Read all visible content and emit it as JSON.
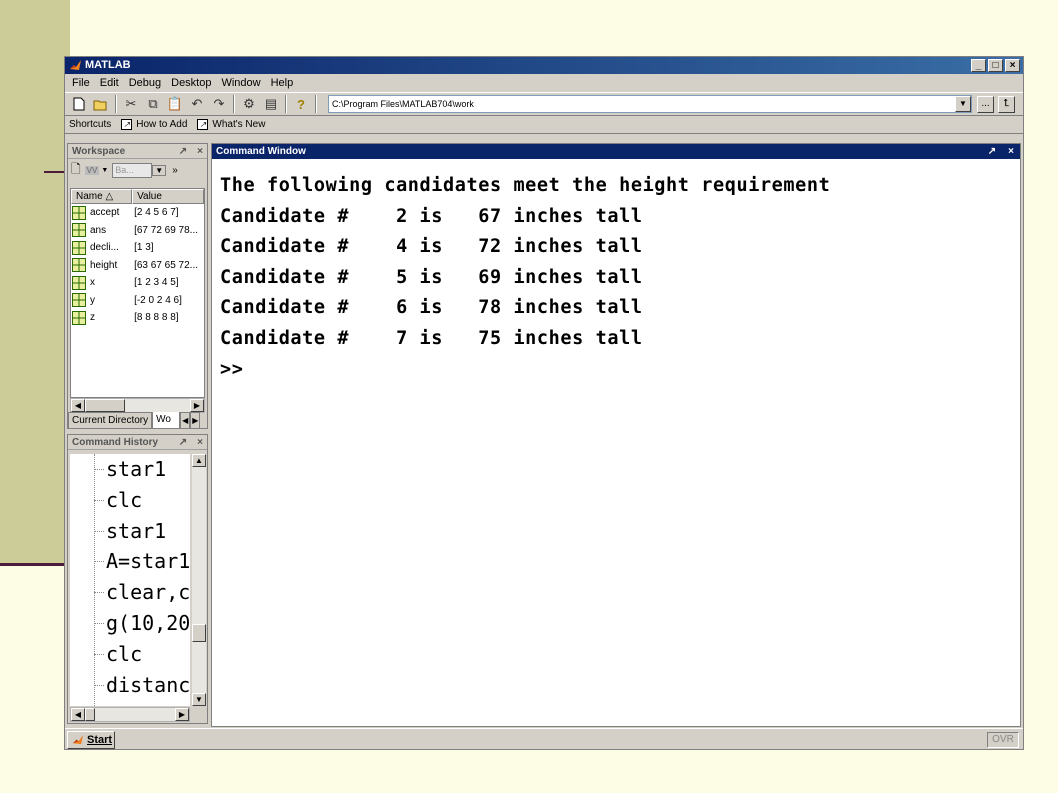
{
  "window": {
    "title": "MATLAB"
  },
  "menu": [
    "File",
    "Edit",
    "Debug",
    "Desktop",
    "Window",
    "Help"
  ],
  "toolbar": {
    "current_directory": "C:\\Program Files\\MATLAB704\\work",
    "browse_label": "..."
  },
  "shortcuts": {
    "label": "Shortcuts",
    "items": [
      "How to Add",
      "What's New"
    ]
  },
  "workspace": {
    "title": "Workspace",
    "combo_value": "Ba...",
    "columns": [
      "Name △",
      "Value"
    ],
    "rows": [
      {
        "name": "accept",
        "value": "[2 4 5 6 7]"
      },
      {
        "name": "ans",
        "value": "[67 72 69 78..."
      },
      {
        "name": "decli...",
        "value": "[1 3]"
      },
      {
        "name": "height",
        "value": "[63 67 65 72..."
      },
      {
        "name": "x",
        "value": "[1 2 3 4 5]"
      },
      {
        "name": "y",
        "value": "[-2 0 2 4 6]"
      },
      {
        "name": "z",
        "value": "[8 8 8 8 8]"
      }
    ],
    "tabs": [
      "Current Directory",
      "Wo"
    ]
  },
  "history": {
    "title": "Command History",
    "items": [
      "star1",
      "clc",
      "star1",
      "A=star1",
      "clear,c",
      "g(10,20",
      "clc",
      "distanc"
    ]
  },
  "command_window": {
    "title": "Command Window",
    "lines": [
      "The following candidates meet the height requirement",
      "Candidate #    2 is   67 inches tall",
      "Candidate #    4 is   72 inches tall",
      "Candidate #    5 is   69 inches tall",
      "Candidate #    6 is   78 inches tall",
      "Candidate #    7 is   75 inches tall",
      ">>"
    ]
  },
  "statusbar": {
    "start_label": "Start",
    "ovr_label": "OVR"
  }
}
